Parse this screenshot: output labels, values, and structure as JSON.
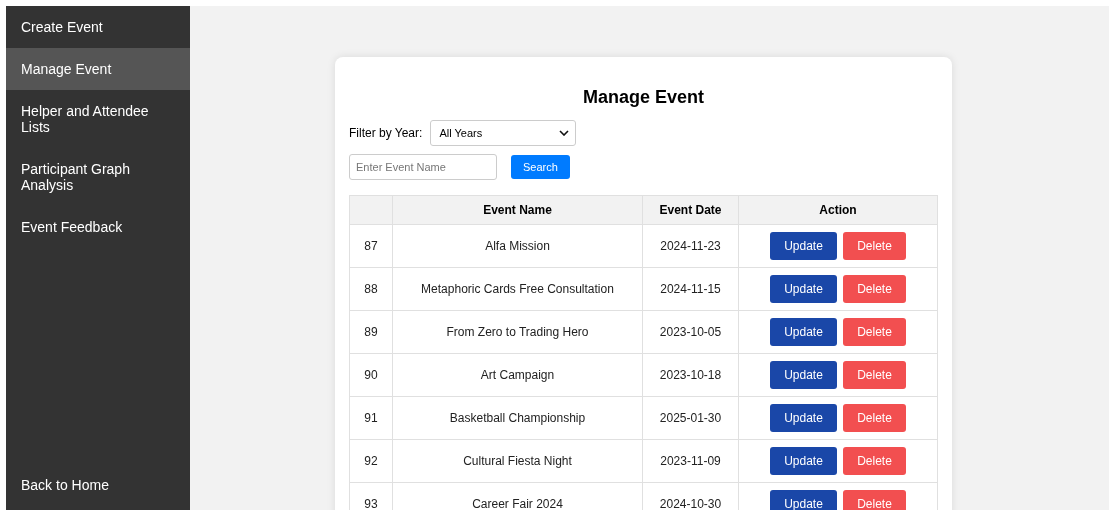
{
  "sidebar": {
    "items": [
      {
        "label": "Create Event",
        "selected": false
      },
      {
        "label": "Manage Event",
        "selected": true
      },
      {
        "label": "Helper and Attendee Lists",
        "selected": false
      },
      {
        "label": "Participant Graph Analysis",
        "selected": false
      },
      {
        "label": "Event Feedback",
        "selected": false
      }
    ],
    "footer_link": "Back to Home"
  },
  "page": {
    "title": "Manage Event",
    "filter_label": "Filter by Year:",
    "filter_value": "All Years",
    "search_placeholder": "Enter Event Name",
    "search_button": "Search"
  },
  "table": {
    "columns": [
      "",
      "Event Name",
      "Event Date",
      "Action"
    ],
    "rows": [
      {
        "id": "87",
        "name": "Alfa Mission",
        "date": "2024-11-23",
        "actions": [
          "Update",
          "Delete"
        ]
      },
      {
        "id": "88",
        "name": "Metaphoric Cards Free Consultation",
        "date": "2024-11-15",
        "actions": [
          "Update",
          "Delete"
        ]
      },
      {
        "id": "89",
        "name": "From Zero to Trading Hero",
        "date": "2023-10-05",
        "actions": [
          "Update",
          "Delete"
        ]
      },
      {
        "id": "90",
        "name": "Art Campaign",
        "date": "2023-10-18",
        "actions": [
          "Update",
          "Delete"
        ]
      },
      {
        "id": "91",
        "name": "Basketball Championship",
        "date": "2025-01-30",
        "actions": [
          "Update",
          "Delete"
        ]
      },
      {
        "id": "92",
        "name": "Cultural Fiesta Night",
        "date": "2023-11-09",
        "actions": [
          "Update",
          "Delete"
        ]
      },
      {
        "id": "93",
        "name": "Career Fair 2024",
        "date": "2024-10-30",
        "actions": [
          "Update",
          "Delete"
        ]
      }
    ]
  }
}
